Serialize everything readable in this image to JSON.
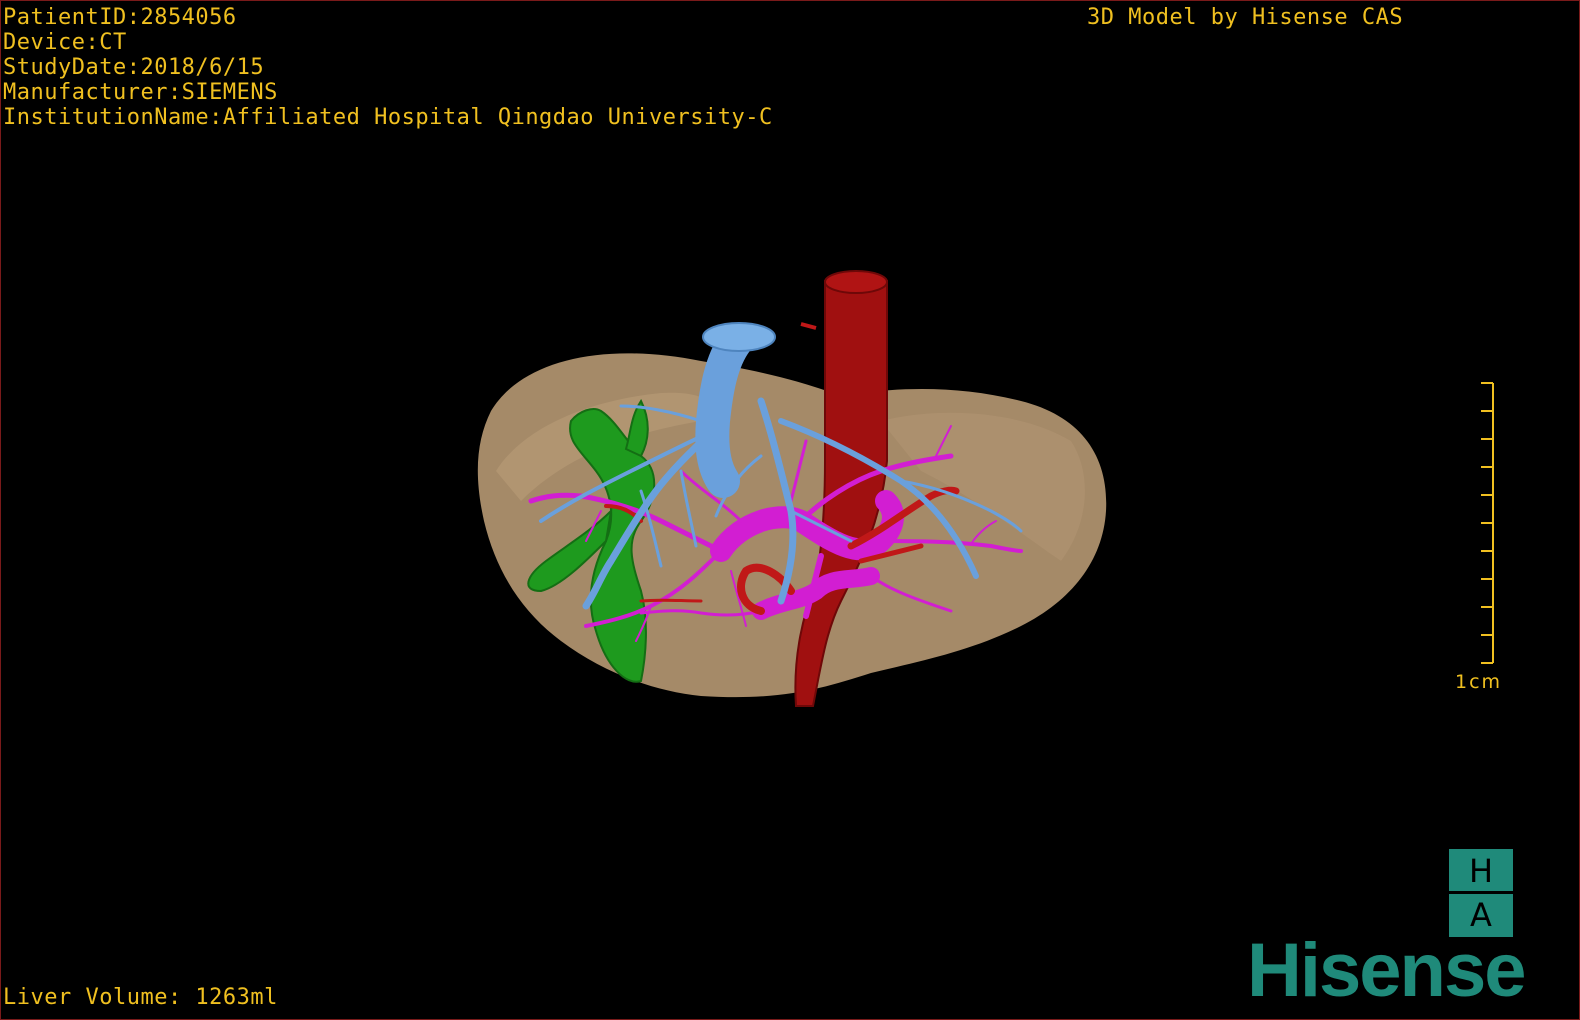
{
  "overlay": {
    "text_color": "#f0c020",
    "patient_id": "PatientID:2854056",
    "device": "Device:CT",
    "study_date": "StudyDate:2018/6/15",
    "manufacturer": "Manufacturer:SIEMENS",
    "institution": "InstitutionName:Affiliated Hospital Qingdao University-C",
    "model_credit": "3D Model by Hisense CAS",
    "liver_volume": "Liver Volume: 1263ml"
  },
  "scale_bar": {
    "label": "1cm",
    "color": "#f0c020",
    "tick_count": 11
  },
  "logo": {
    "top_letter": "H",
    "bottom_letter": "A",
    "brand": "Hisense",
    "brand_color": "#1f8a7a"
  },
  "render_colors": {
    "background": "#000000",
    "liver": "#a58a68",
    "aorta": "#a01010",
    "hepatic_vein": "#6aa0dc",
    "portal_vein": "#d21ed2",
    "biliary": "#1e9a1e",
    "artery": "#c01818"
  }
}
